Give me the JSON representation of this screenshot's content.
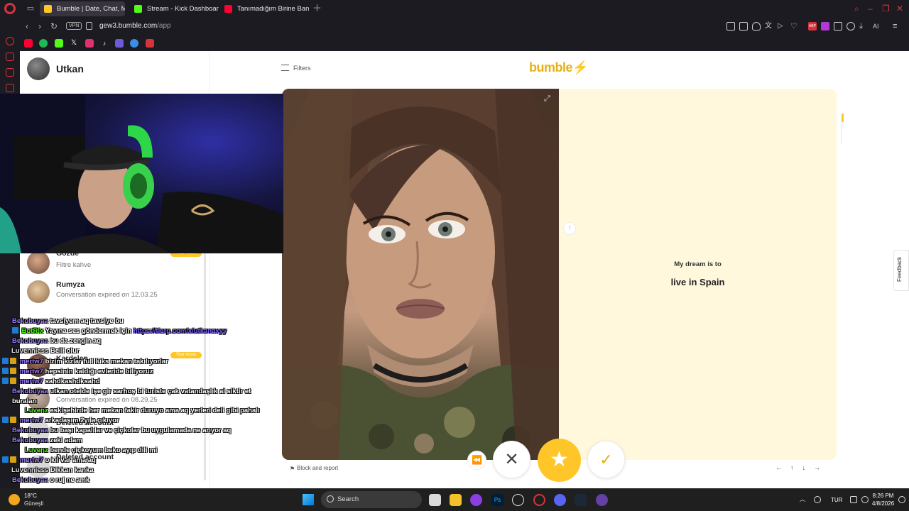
{
  "browser": {
    "tabs": [
      {
        "label": "Bumble | Date, Chat, Meet",
        "active": true,
        "color": "#ffc629"
      },
      {
        "label": "Stream - Kick Dashboard",
        "active": false,
        "color": "#53fc18"
      },
      {
        "label": "Tanımadığım Birine Banka",
        "active": false,
        "color": "#ff0033"
      }
    ],
    "vpn_label": "VPN",
    "url_host": "gew3.bumble.com",
    "url_path": "/app",
    "ai_label": "AI",
    "abp_label": "ABP"
  },
  "app": {
    "user_name": "Utkan",
    "filters_label": "Filters",
    "logo": "bumble",
    "conversations": [
      {
        "name": "Gözde",
        "subtitle": "Filtre kahve",
        "your_move": true
      },
      {
        "name": "Rumyza",
        "subtitle": "Conversation expired on 12.03.25",
        "your_move": false
      },
      {
        "name": "Kardelen",
        "subtitle": "",
        "your_move": true
      },
      {
        "name": "Pea",
        "subtitle": "Conversation expired on 08.29.25",
        "your_move": false
      },
      {
        "name": "Deleted account",
        "subtitle": "",
        "your_move": false
      },
      {
        "name": "Deleted account",
        "subtitle": "",
        "your_move": false
      }
    ],
    "your_move_label": "Your move",
    "profile": {
      "dream_question": "My dream is to",
      "dream_answer": "live in Spain"
    },
    "block_report": "Block and report",
    "feedback": "Feedback",
    "colors": {
      "accent": "#ffc629",
      "card_bg": "#fff8dd"
    }
  },
  "chat": [
    {
      "user": "Bekobuyaa",
      "color": "#9b7dff",
      "badge": "",
      "msg": "tavsiyem aq tavsiye bu"
    },
    {
      "user": "BotRix",
      "color": "#53fc18",
      "badge": "b",
      "msg": "Yayına ses göndermek için ",
      "link": "https://tierp.com/x/utkanaxyy"
    },
    {
      "user": "Bekobuyaa",
      "color": "#9b7dff",
      "badge": "",
      "msg": "bu da zengin aq"
    },
    {
      "user": "Luvenniess",
      "color": "#e0e0e0",
      "badge": "",
      "msg": "Belli olur"
    },
    {
      "user": "mertw7",
      "color": "#9b7dff",
      "badge": "bg",
      "msg": "bizim kızlar full lüks mekan takılıyorlar"
    },
    {
      "user": "mertw7",
      "color": "#9b7dff",
      "badge": "bg",
      "msg": "hepsinin kaldığı evleride biliyoruz"
    },
    {
      "user": "mertw7",
      "color": "#9b7dff",
      "badge": "bg",
      "msg": "sahdkashdksahd"
    },
    {
      "user": "Bekobuyaa",
      "color": "#9b7dff",
      "badge": "",
      "msg": "utkan otelde işe gir sarhoş bi turiste çak vatandaşlık al siktir et buraları"
    },
    {
      "user": "Luvenz",
      "color": "#53fc18",
      "badge": "",
      "msg": "eskişehirde her mekan fakir duruyo ama aq yerleri deli gibi pahalı"
    },
    {
      "user": "mertw7",
      "color": "#9b7dff",
      "badge": "bg",
      "msg": "arkadaşım 2yıla çıkıyor"
    },
    {
      "user": "Bekobuyaa",
      "color": "#9b7dff",
      "badge": "",
      "msg": "bu başı kapalılar ve çiçkolar bu uygulamada ne arıyor aq"
    },
    {
      "user": "Bekobuyaa",
      "color": "#9b7dff",
      "badge": "",
      "msg": "zeki adam"
    },
    {
      "user": "Luvenz",
      "color": "#53fc18",
      "badge": "",
      "msg": "bende çiçkoyum beko ayıp dili mi"
    },
    {
      "user": "mertw7",
      "color": "#9b7dff",
      "badge": "bg",
      "msg": "o kil var ama aq"
    },
    {
      "user": "Luvenniess",
      "color": "#e0e0e0",
      "badge": "",
      "msg": "Dikkan kanka"
    },
    {
      "user": "Bekobuyaa",
      "color": "#9b7dff",
      "badge": "",
      "msg": "o ruj ne amk"
    }
  ],
  "taskbar": {
    "temperature": "18°C",
    "weather": "Güneşli",
    "search": "Search",
    "language": "TUR",
    "time": "8:26 PM",
    "date": "4/8/2026"
  }
}
